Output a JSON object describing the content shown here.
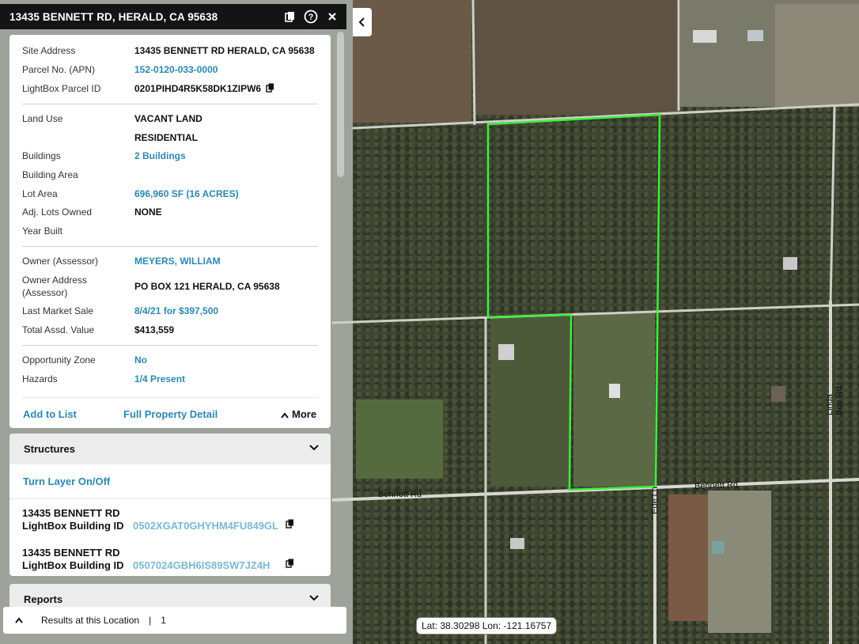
{
  "header": {
    "title": "13435 BENNETT RD, HERALD, CA 95638"
  },
  "details": {
    "site_address": {
      "label": "Site Address",
      "value": "13435 BENNETT RD HERALD, CA 95638"
    },
    "parcel_no": {
      "label": "Parcel No. (APN)",
      "value": "152-0120-033-0000"
    },
    "lightbox_parcel_id": {
      "label": "LightBox Parcel ID",
      "value": "0201PIHD4R5K58DK1ZIPW6"
    },
    "land_use": {
      "label": "Land Use",
      "value": "VACANT LAND",
      "value2": "RESIDENTIAL"
    },
    "buildings": {
      "label": "Buildings",
      "value": "2 Buildings"
    },
    "building_area": {
      "label": "Building Area",
      "value": ""
    },
    "lot_area": {
      "label": "Lot Area",
      "value": "696,960 SF (16 ACRES)"
    },
    "adj_lots": {
      "label": "Adj. Lots Owned",
      "value": "NONE"
    },
    "year_built": {
      "label": "Year Built",
      "value": ""
    },
    "owner": {
      "label": "Owner (Assessor)",
      "value": "MEYERS, WILLIAM"
    },
    "owner_address": {
      "label_line1": "Owner Address",
      "label_line2": "(Assessor)",
      "value": "PO BOX 121 HERALD, CA 95638"
    },
    "last_sale": {
      "label": "Last Market Sale",
      "value": "8/4/21 for $397,500"
    },
    "total_value": {
      "label": "Total Assd. Value",
      "value": "$413,559"
    },
    "opportunity_zone": {
      "label": "Opportunity Zone",
      "value": "No"
    },
    "hazards": {
      "label": "Hazards",
      "value": "1/4 Present"
    },
    "actions": {
      "add_to_list": "Add to List",
      "full_detail": "Full Property Detail",
      "more": "More"
    }
  },
  "structures": {
    "title": "Structures",
    "turn_layer": "Turn Layer On/Off",
    "items": [
      {
        "address": "13435 BENNETT RD",
        "id_label": "LightBox Building ID",
        "id": "0502XGAT0GHYHM4FU849GL"
      },
      {
        "address": "13435 BENNETT RD",
        "id_label": "LightBox Building ID",
        "id": "0507024GBH6IS89SW7JZ4H"
      }
    ]
  },
  "reports": {
    "title": "Reports"
  },
  "results": {
    "label": "Results at this Location",
    "separator": "|",
    "count": "1"
  },
  "map": {
    "coords": "Lat: 38.30298 Lon: -121.16757",
    "roads": {
      "bennett_left": "Bennett Rd",
      "bennett_right": "Bennett Rd",
      "ede": "Ede Ln",
      "linda_bee": "Linda Bee Rd"
    },
    "parcel_outline_color": "#3cf03c",
    "accent_link_color": "#2b88b1"
  },
  "icons": {
    "copy": "copy-icon",
    "help": "help-icon",
    "close": "close-icon",
    "chevron_down": "chevron-down-icon",
    "chevron_up": "chevron-up-icon",
    "chevron_left": "chevron-left-icon"
  }
}
